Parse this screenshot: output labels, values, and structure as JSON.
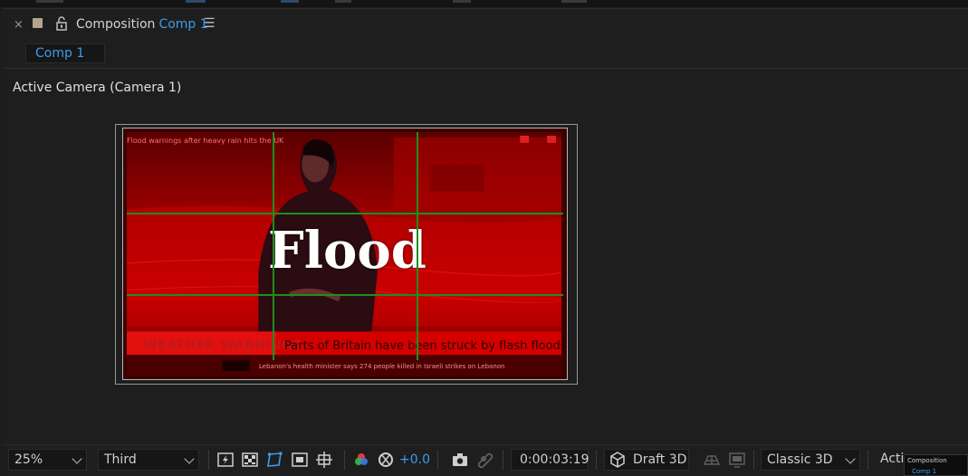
{
  "panel": {
    "title": "Composition",
    "comp_name": "Comp 1",
    "close_glyph": "×",
    "menu_glyph": "☰",
    "subtab_label": "Comp 1"
  },
  "viewer": {
    "camera_label": "Active Camera (Camera 1)",
    "title_text": "Flood",
    "scene_headline": "Parts of Britain have been struck by flash floods",
    "scene_banner": "WEATHER WARNINGS",
    "scene_ticker_top": "Flood warnings after heavy rain hits the UK",
    "scene_ticker_bottom": "Lebanon's health minister says 274 people killed in Israeli strikes on Lebanon",
    "grid": "rule-of-thirds",
    "grid_color": "#1d8f1d"
  },
  "toolbar": {
    "zoom": "25%",
    "view_mode": "Third",
    "exposure": "+0.0",
    "timecode": "0:00:03:19",
    "renderer_mode": "Draft 3D",
    "renderer": "Classic 3D",
    "view_layout_truncated": "Acti"
  },
  "thumbnail": {
    "title": "Composition",
    "comp": "Comp 1"
  },
  "colors": {
    "accent": "#3b9cf0",
    "background": "#1e1e1e",
    "scene_red": "#c00000"
  },
  "icons": [
    "close-icon",
    "label-swatch-icon",
    "lock-icon",
    "panel-menu-icon",
    "fast-preview-icon",
    "transparency-grid-icon",
    "mask-visibility-icon",
    "region-of-interest-icon",
    "grid-guides-icon",
    "color-channel-icon",
    "reset-exposure-icon",
    "snapshot-icon",
    "show-snapshot-icon",
    "draft-3d-icon",
    "extended-viewer-icon",
    "3d-ground-plane-icon"
  ]
}
